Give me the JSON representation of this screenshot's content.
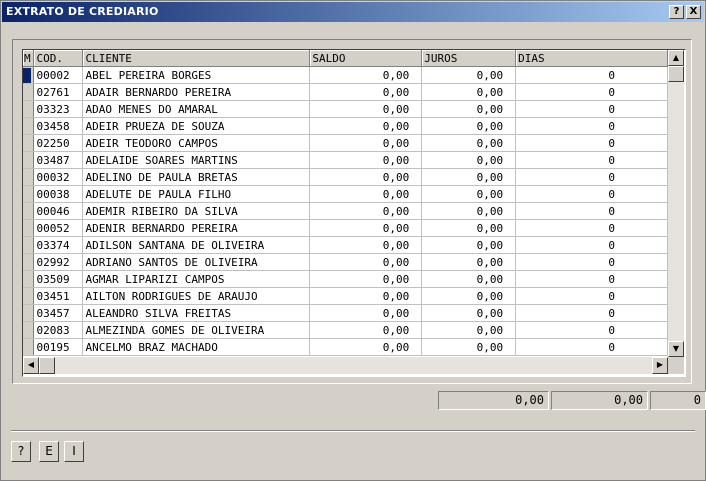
{
  "window": {
    "title": "EXTRATO DE CREDIARIO",
    "help_button": "?",
    "close_button": "X"
  },
  "grid": {
    "columns": [
      "M",
      "COD.",
      "CLIENTE",
      "SALDO",
      "JUROS",
      "DIAS"
    ],
    "rows": [
      {
        "cod": "00002",
        "cliente": "ABEL PEREIRA BORGES",
        "saldo": "0,00",
        "juros": "0,00",
        "dias": "0"
      },
      {
        "cod": "02761",
        "cliente": "ADAIR BERNARDO PEREIRA",
        "saldo": "0,00",
        "juros": "0,00",
        "dias": "0"
      },
      {
        "cod": "03323",
        "cliente": "ADAO MENES DO AMARAL",
        "saldo": "0,00",
        "juros": "0,00",
        "dias": "0"
      },
      {
        "cod": "03458",
        "cliente": "ADEIR PRUEZA DE SOUZA",
        "saldo": "0,00",
        "juros": "0,00",
        "dias": "0"
      },
      {
        "cod": "02250",
        "cliente": "ADEIR TEODORO CAMPOS",
        "saldo": "0,00",
        "juros": "0,00",
        "dias": "0"
      },
      {
        "cod": "03487",
        "cliente": "ADELAIDE SOARES MARTINS",
        "saldo": "0,00",
        "juros": "0,00",
        "dias": "0"
      },
      {
        "cod": "00032",
        "cliente": "ADELINO DE PAULA BRETAS",
        "saldo": "0,00",
        "juros": "0,00",
        "dias": "0"
      },
      {
        "cod": "00038",
        "cliente": "ADELUTE DE PAULA FILHO",
        "saldo": "0,00",
        "juros": "0,00",
        "dias": "0"
      },
      {
        "cod": "00046",
        "cliente": "ADEMIR RIBEIRO DA SILVA",
        "saldo": "0,00",
        "juros": "0,00",
        "dias": "0"
      },
      {
        "cod": "00052",
        "cliente": "ADENIR BERNARDO PEREIRA",
        "saldo": "0,00",
        "juros": "0,00",
        "dias": "0"
      },
      {
        "cod": "03374",
        "cliente": "ADILSON SANTANA DE OLIVEIRA",
        "saldo": "0,00",
        "juros": "0,00",
        "dias": "0"
      },
      {
        "cod": "02992",
        "cliente": "ADRIANO SANTOS DE OLIVEIRA",
        "saldo": "0,00",
        "juros": "0,00",
        "dias": "0"
      },
      {
        "cod": "03509",
        "cliente": "AGMAR LIPARIZI CAMPOS",
        "saldo": "0,00",
        "juros": "0,00",
        "dias": "0"
      },
      {
        "cod": "03451",
        "cliente": "AILTON RODRIGUES DE ARAUJO",
        "saldo": "0,00",
        "juros": "0,00",
        "dias": "0"
      },
      {
        "cod": "03457",
        "cliente": "ALEANDRO SILVA FREITAS",
        "saldo": "0,00",
        "juros": "0,00",
        "dias": "0"
      },
      {
        "cod": "02083",
        "cliente": "ALMEZINDA GOMES DE OLIVEIRA",
        "saldo": "0,00",
        "juros": "0,00",
        "dias": "0"
      },
      {
        "cod": "00195",
        "cliente": "ANCELMO BRAZ MACHADO",
        "saldo": "0,00",
        "juros": "0,00",
        "dias": "0"
      }
    ]
  },
  "totals": {
    "saldo": "0,00",
    "juros": "0,00",
    "dias": "0"
  },
  "buttons": {
    "help": "?",
    "e": "E",
    "i": "I"
  },
  "colors": {
    "title_start": "#0a246a",
    "title_end": "#a6caf0",
    "face": "#d4d0c8",
    "record_marker": "#0a246a"
  },
  "icons": {
    "scroll_up": "up-arrow-icon",
    "scroll_down": "down-arrow-icon",
    "scroll_left": "left-arrow-icon",
    "scroll_right": "right-arrow-icon"
  }
}
